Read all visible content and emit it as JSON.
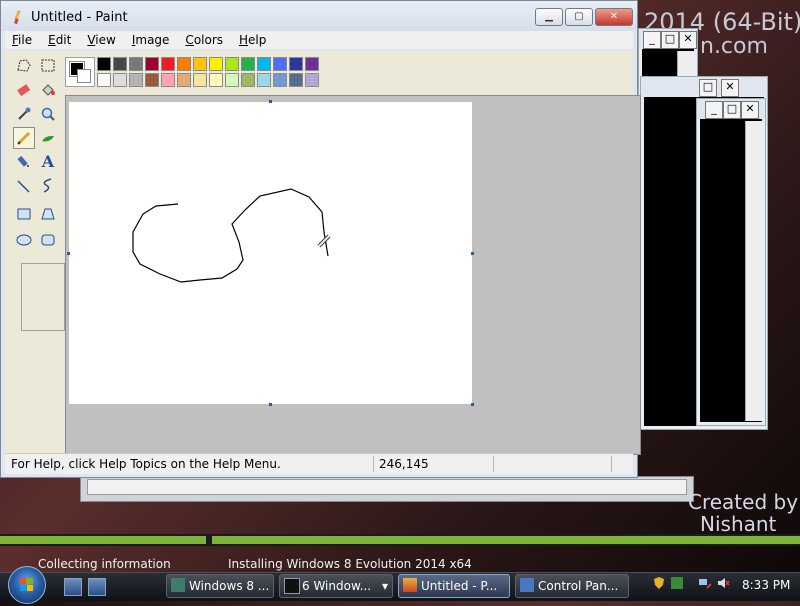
{
  "background": {
    "title_line1": "2014 (64-Bit)",
    "title_line2": "n.com",
    "credit_line1": "Created by",
    "credit_line2": "Nishant"
  },
  "installer": {
    "status_left": "Collecting information",
    "status_right": "Installing Windows 8 Evolution 2014 x64",
    "segments": [
      {
        "label": "Collecting information",
        "progress": 1.0
      },
      {
        "label": "Installing Windows 8 Evolution 2014 x64",
        "progress": 1.0
      }
    ]
  },
  "paint": {
    "title": "Untitled - Paint",
    "window_buttons": {
      "minimize": "▁",
      "maximize": "▢",
      "close": "✕"
    },
    "menu": [
      "File",
      "Edit",
      "View",
      "Image",
      "Colors",
      "Help"
    ],
    "tools": [
      {
        "name": "free-form-select"
      },
      {
        "name": "rect-select"
      },
      {
        "name": "eraser"
      },
      {
        "name": "fill"
      },
      {
        "name": "pick-color"
      },
      {
        "name": "magnifier"
      },
      {
        "name": "pencil",
        "selected": true
      },
      {
        "name": "brush"
      },
      {
        "name": "airbrush"
      },
      {
        "name": "text",
        "glyph": "A"
      },
      {
        "name": "line"
      },
      {
        "name": "curve"
      },
      {
        "name": "rectangle"
      },
      {
        "name": "polygon"
      },
      {
        "name": "ellipse"
      },
      {
        "name": "rounded-rectangle"
      }
    ],
    "foreground_color": "#000000",
    "background_color": "#ffffff",
    "palette": [
      "#000000",
      "#464646",
      "#787878",
      "#990030",
      "#ed1c24",
      "#ff7e00",
      "#ffc20e",
      "#fff200",
      "#a8e61d",
      "#22b14c",
      "#00b7ef",
      "#4d6df3",
      "#2f3699",
      "#6f3198",
      "#ffffff",
      "#dcdcdc",
      "#b4b4b4",
      "#9c5a3c",
      "#ffa3b1",
      "#e5aa7a",
      "#f5e49c",
      "#fff9bd",
      "#d3f9bc",
      "#9dbb61",
      "#99d9ea",
      "#709ad1",
      "#546d8e",
      "#b5a5d5"
    ],
    "status_help": "For Help, click Help Topics on the Help Menu.",
    "status_coords": "246,145"
  },
  "taskbar": {
    "tasks": [
      {
        "label": "Windows 8 ..."
      },
      {
        "label": "6 Window...",
        "count": "6"
      },
      {
        "label": "Untitled - P...",
        "active": true
      },
      {
        "label": "Control Pan..."
      }
    ],
    "clock": "8:33 PM"
  },
  "console_buttons": {
    "minimize": "_",
    "maximize": "□",
    "close": "✕"
  }
}
